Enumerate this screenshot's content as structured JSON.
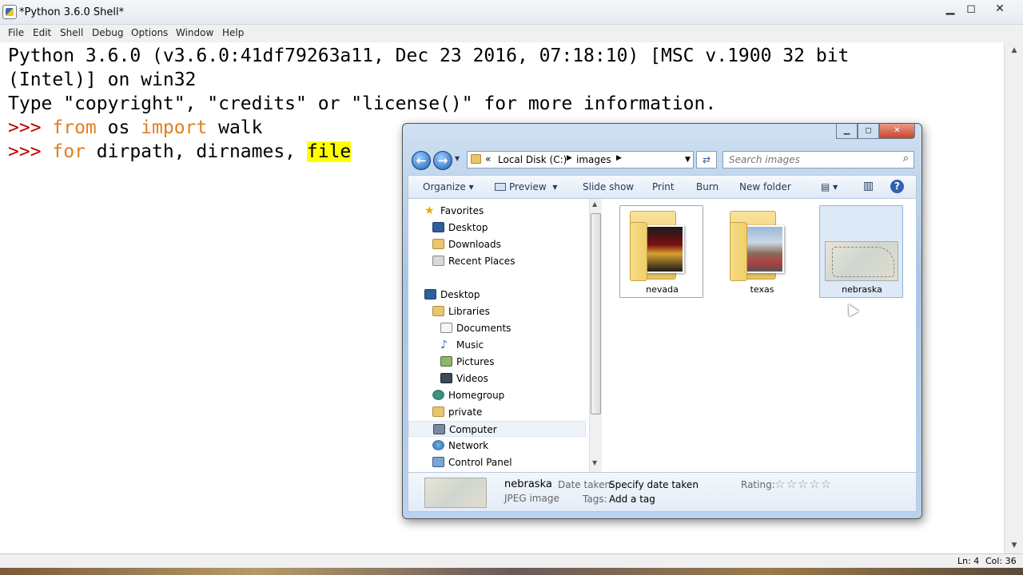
{
  "shell": {
    "title": "*Python 3.6.0 Shell*",
    "menu": [
      "File",
      "Edit",
      "Shell",
      "Debug",
      "Options",
      "Window",
      "Help"
    ],
    "lines": {
      "l1": "Python 3.6.0 (v3.6.0:41df79263a11, Dec 23 2016, 07:18:10) [MSC v.1900 32 bit",
      "l2": "(Intel)] on win32",
      "l3": "Type \"copyright\", \"credits\" or \"license()\" for more information.",
      "p": ">>> ",
      "from": "from",
      "os": " os ",
      "import": "import",
      "walk": " walk",
      "for": "for",
      "rest": " dirpath, dirnames, ",
      "hl": "file"
    },
    "status": {
      "ln": "Ln: 4",
      "col": "Col: 36"
    }
  },
  "explorer": {
    "address": {
      "root": "Local Disk (C:)",
      "folder": "images"
    },
    "search_placeholder": "Search images",
    "toolbar": {
      "organize": "Organize",
      "preview": "Preview",
      "slideshow": "Slide show",
      "print": "Print",
      "burn": "Burn",
      "newfolder": "New folder"
    },
    "nav": {
      "favorites": "Favorites",
      "desktop_fav": "Desktop",
      "downloads": "Downloads",
      "recent": "Recent Places",
      "desktop": "Desktop",
      "libraries": "Libraries",
      "documents": "Documents",
      "music": "Music",
      "pictures": "Pictures",
      "videos": "Videos",
      "homegroup": "Homegroup",
      "private": "private",
      "computer": "Computer",
      "network": "Network",
      "controlpanel": "Control Panel"
    },
    "items": {
      "nevada": "nevada",
      "texas": "texas",
      "nebraska": "nebraska"
    },
    "details": {
      "name": "nebraska",
      "type": "JPEG image",
      "date_label": "Date taken:",
      "date_value": "Specify date taken",
      "tags_label": "Tags:",
      "tags_value": "Add a tag",
      "rating_label": "Rating:",
      "stars": "☆☆☆☆☆"
    }
  }
}
